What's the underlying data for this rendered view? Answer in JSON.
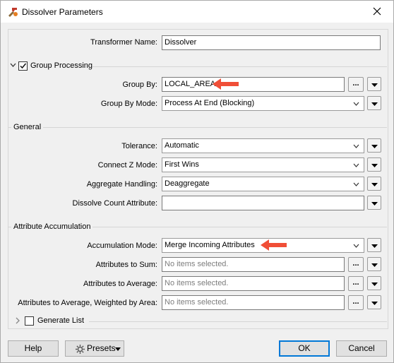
{
  "window": {
    "title": "Dissolver Parameters"
  },
  "transformer_name": {
    "label": "Transformer Name:",
    "value": "Dissolver"
  },
  "group_processing": {
    "title": "Group Processing",
    "checked": true,
    "group_by": {
      "label": "Group By:",
      "value": "LOCAL_AREA"
    },
    "group_by_mode": {
      "label": "Group By Mode:",
      "value": "Process At End (Blocking)"
    }
  },
  "general": {
    "title": "General",
    "tolerance": {
      "label": "Tolerance:",
      "value": "Automatic"
    },
    "connect_z_mode": {
      "label": "Connect Z Mode:",
      "value": "First Wins"
    },
    "aggregate_handling": {
      "label": "Aggregate Handling:",
      "value": "Deaggregate"
    },
    "dissolve_count_attribute": {
      "label": "Dissolve Count Attribute:",
      "value": ""
    }
  },
  "attribute_accumulation": {
    "title": "Attribute Accumulation",
    "accumulation_mode": {
      "label": "Accumulation Mode:",
      "value": "Merge Incoming Attributes"
    },
    "attributes_to_sum": {
      "label": "Attributes to Sum:",
      "placeholder": "No items selected."
    },
    "attributes_to_average": {
      "label": "Attributes to Average:",
      "placeholder": "No items selected."
    },
    "attributes_to_average_weighted": {
      "label": "Attributes to Average, Weighted by Area:",
      "placeholder": "No items selected."
    }
  },
  "generate_list": {
    "label": "Generate List",
    "checked": false
  },
  "buttons": {
    "help": "Help",
    "presets": "Presets",
    "ok": "OK",
    "cancel": "Cancel",
    "ellipsis": "..."
  },
  "colors": {
    "annotation_arrow": "#f04e37",
    "focus_border": "#0078d7"
  },
  "icons": {
    "app": "fme-transformer-icon",
    "close": "close-icon",
    "expand": "chevron-down-icon",
    "collapsed": "chevron-right-icon",
    "menu": "triangle-down-icon",
    "gear": "gear-icon"
  }
}
